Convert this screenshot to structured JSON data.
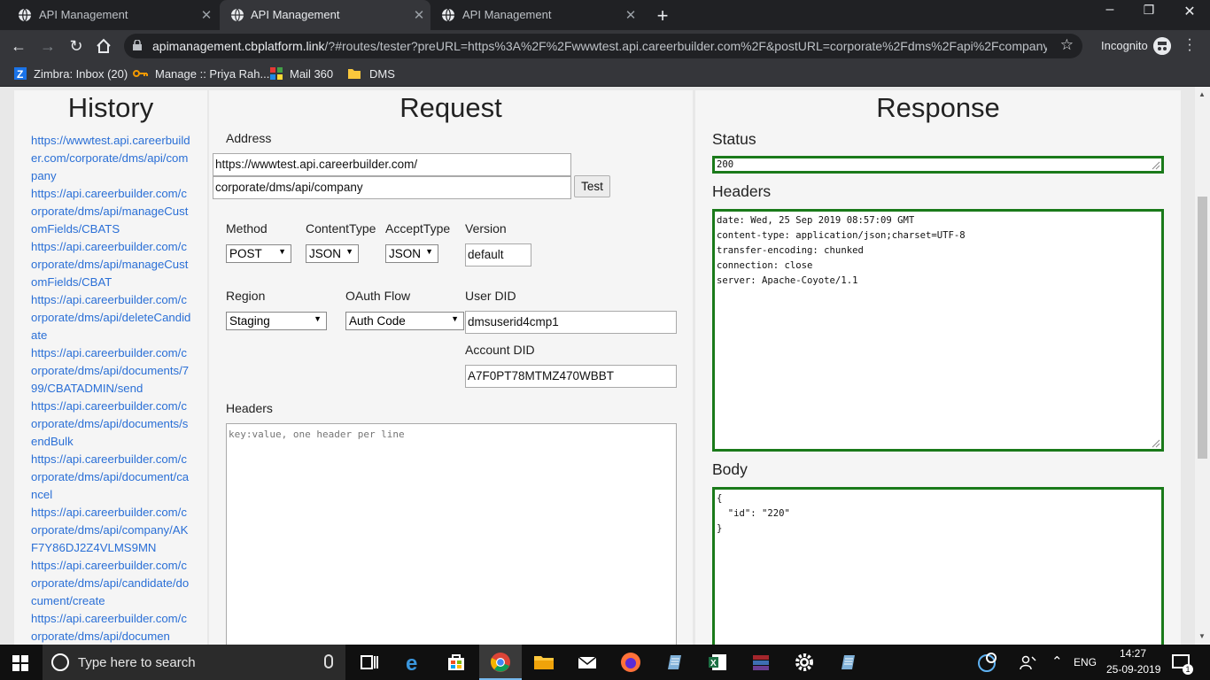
{
  "browser": {
    "tabs": [
      {
        "title": "API Management",
        "active": false
      },
      {
        "title": "API Management",
        "active": true
      },
      {
        "title": "API Management",
        "active": false
      }
    ],
    "url_host": "apimanagement.cbplatform.link",
    "url_rest": "/?#routes/tester?preURL=https%3A%2F%2Fwwwtest.api.careerbuilder.com%2F&postURL=corporate%2Fdms%2Fapi%2Fcompany...",
    "incognito_label": "Incognito",
    "bookmarks": [
      {
        "label": "Zimbra: Inbox (20)",
        "icon": "zimbra-icon"
      },
      {
        "label": "Manage :: Priya Rah...",
        "icon": "key-icon"
      },
      {
        "label": "Mail 360",
        "icon": "grid-icon"
      },
      {
        "label": "DMS",
        "icon": "folder-icon"
      }
    ]
  },
  "history": {
    "title": "History",
    "items": [
      "https://wwwtest.api.careerbuilder.com/corporate/dms/api/company",
      "https://api.careerbuilder.com/corporate/dms/api/manageCustomFields/CBATS",
      "https://api.careerbuilder.com/corporate/dms/api/manageCustomFields/CBAT",
      "https://api.careerbuilder.com/corporate/dms/api/deleteCandidate",
      "https://api.careerbuilder.com/corporate/dms/api/documents/799/CBATADMIN/send",
      "https://api.careerbuilder.com/corporate/dms/api/documents/sendBulk",
      "https://api.careerbuilder.com/corporate/dms/api/document/cancel",
      "https://api.careerbuilder.com/corporate/dms/api/company/AKF7Y86DJ2Z4VLMS9MN",
      "https://api.careerbuilder.com/corporate/dms/api/candidate/document/create",
      "https://api.careerbuilder.com/corporate/dms/api/documen"
    ]
  },
  "request": {
    "title": "Request",
    "address_label": "Address",
    "address_base": "https://wwwtest.api.careerbuilder.com/",
    "address_path": "corporate/dms/api/company",
    "test_label": "Test",
    "method_label": "Method",
    "method_value": "POST",
    "contenttype_label": "ContentType",
    "contenttype_value": "JSON",
    "accepttype_label": "AcceptType",
    "accepttype_value": "JSON",
    "version_label": "Version",
    "version_value": "default",
    "region_label": "Region",
    "region_value": "Staging",
    "oauth_label": "OAuth Flow",
    "oauth_value": "Auth Code",
    "userdid_label": "User DID",
    "userdid_value": "dmsuserid4cmp1",
    "accountdid_label": "Account DID",
    "accountdid_value": "A7F0PT78MTMZ470WBBT",
    "headers_label": "Headers",
    "headers_placeholder": "key:value, one header per line"
  },
  "response": {
    "title": "Response",
    "status_label": "Status",
    "status_value": "200",
    "headers_label": "Headers",
    "headers_value": "date: Wed, 25 Sep 2019 08:57:09 GMT\ncontent-type: application/json;charset=UTF-8\ntransfer-encoding: chunked\nconnection: close\nserver: Apache-Coyote/1.1",
    "body_label": "Body",
    "body_value": "{\n  \"id\": \"220\"\n}",
    "accent_color": "#1a7a1a"
  },
  "taskbar": {
    "search_placeholder": "Type here to search",
    "language": "ENG",
    "time": "14:27",
    "date": "25-09-2019",
    "notification_count": "1"
  }
}
